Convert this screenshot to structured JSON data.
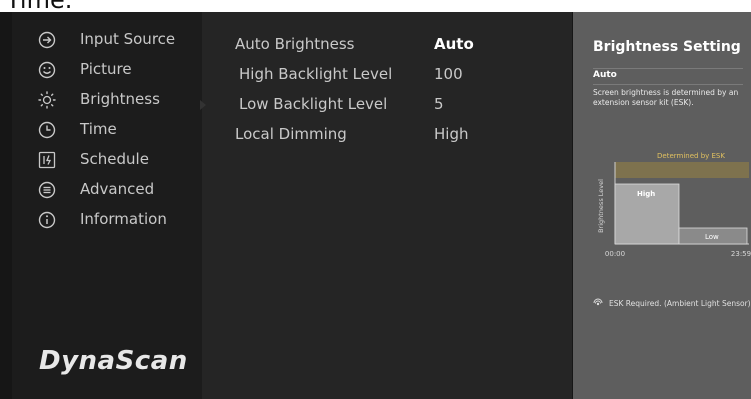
{
  "top_strip": {
    "text": "Time."
  },
  "sidebar": {
    "items": [
      {
        "label": "Input Source",
        "icon": "input-source-icon"
      },
      {
        "label": "Picture",
        "icon": "picture-icon"
      },
      {
        "label": "Brightness",
        "icon": "brightness-icon"
      },
      {
        "label": "Time",
        "icon": "clock-icon"
      },
      {
        "label": "Schedule",
        "icon": "schedule-icon"
      },
      {
        "label": "Advanced",
        "icon": "advanced-icon"
      },
      {
        "label": "Information",
        "icon": "info-icon"
      }
    ],
    "selected": "Brightness",
    "logo": "DynaScan"
  },
  "main": {
    "rows": [
      {
        "label": "Auto Brightness",
        "value": "Auto"
      },
      {
        "label": "High Backlight Level",
        "value": "100"
      },
      {
        "label": "Low Backlight Level",
        "value": "5"
      },
      {
        "label": "Local Dimming",
        "value": "High"
      }
    ]
  },
  "help": {
    "title": "Brightness Setting",
    "subtitle": "Auto",
    "description": "Screen brightness is determined by an extension sensor kit (ESK).",
    "chart": {
      "band_label": "Determined by ESK",
      "y_axis_label": "Brightness Level",
      "high_label": "High",
      "low_label": "Low",
      "x_start": "00:00",
      "x_end": "23:59"
    },
    "footer": "ESK Required. (Ambient Light Sensor)"
  },
  "colors": {
    "screen_bg": "#161616",
    "sidebar_bg": "#1c1c1c",
    "main_bg": "#252525",
    "help_bg": "#5e5e5e",
    "band_color": "#8a7a4a"
  }
}
